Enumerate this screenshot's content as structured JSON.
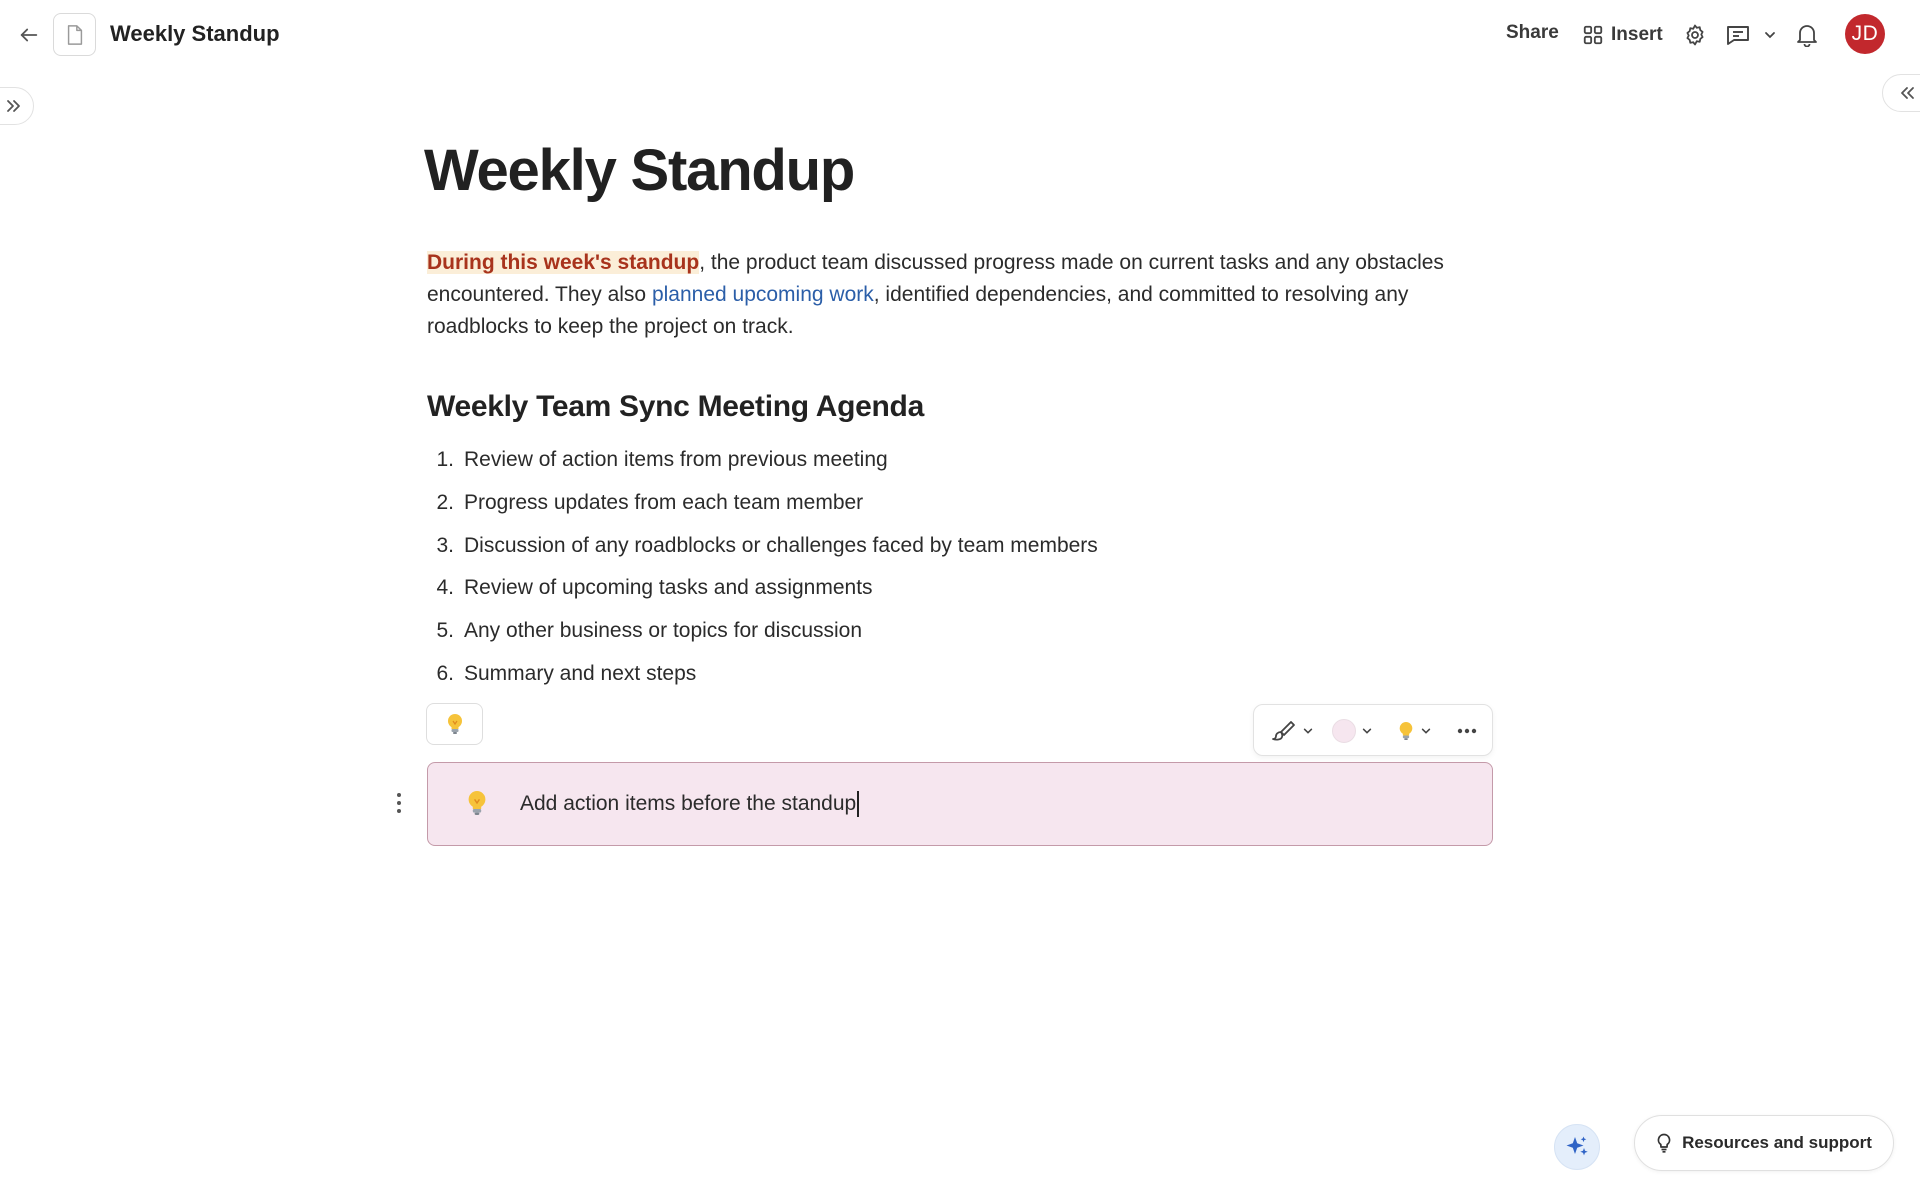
{
  "header": {
    "title": "Weekly Standup",
    "share_label": "Share",
    "insert_label": "Insert",
    "avatar_initials": "JD",
    "avatar_color": "#c2282d"
  },
  "document": {
    "heading": "Weekly Standup",
    "intro": {
      "highlight": "During this week's standup",
      "part1": ", the product team discussed progress made on current tasks and any obstacles encountered. They also ",
      "link": "planned upcoming work",
      "part2": ", identified dependencies, and committed to resolving any roadblocks to keep the project on track."
    },
    "agenda_heading": "Weekly Team Sync Meeting Agenda",
    "agenda_items": [
      {
        "num": "1.",
        "text": "Review of action items from previous meeting"
      },
      {
        "num": "2.",
        "text": "Progress updates from each team member"
      },
      {
        "num": "3.",
        "text": "Discussion of any roadblocks or challenges faced by team members"
      },
      {
        "num": "4.",
        "text": "Review of upcoming tasks and assignments"
      },
      {
        "num": "5.",
        "text": "Any other business or topics for discussion"
      },
      {
        "num": "6.",
        "text": "Summary and next steps"
      }
    ],
    "callout": {
      "emoji": "lightbulb-icon",
      "text": "Add action items before the standup",
      "background": "#f6e6ef"
    }
  },
  "footer": {
    "resources_label": "Resources and support"
  },
  "colors": {
    "highlight_bg": "#fbeed8",
    "highlight_text": "#a8331c",
    "link": "#2b5ea8",
    "callout_border": "#c49aa9"
  }
}
